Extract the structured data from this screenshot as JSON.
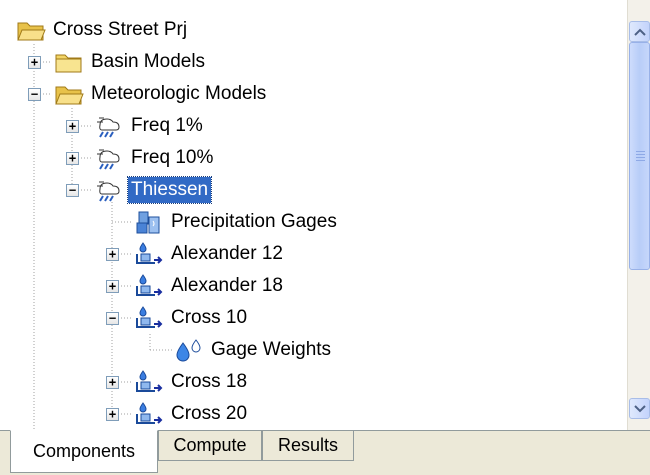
{
  "tree": {
    "root": "Cross Street Prj",
    "basin_models": "Basin Models",
    "met_models": "Meteorologic Models",
    "freq1": "Freq 1%",
    "freq10": "Freq 10%",
    "thiessen": "Thiessen",
    "precip_gages": "Precipitation Gages",
    "alex12": "Alexander 12",
    "alex18": "Alexander 18",
    "cross10": "Cross 10",
    "gage_weights": "Gage Weights",
    "cross18": "Cross 18",
    "cross20": "Cross 20"
  },
  "tabs": {
    "components": "Components",
    "compute": "Compute",
    "results": "Results"
  },
  "expander_glyphs": {
    "plus": "+",
    "minus": "−"
  },
  "colors": {
    "selection": "#316ac5",
    "folder": "#f2d466",
    "gage_blue": "#1e5bc6"
  }
}
